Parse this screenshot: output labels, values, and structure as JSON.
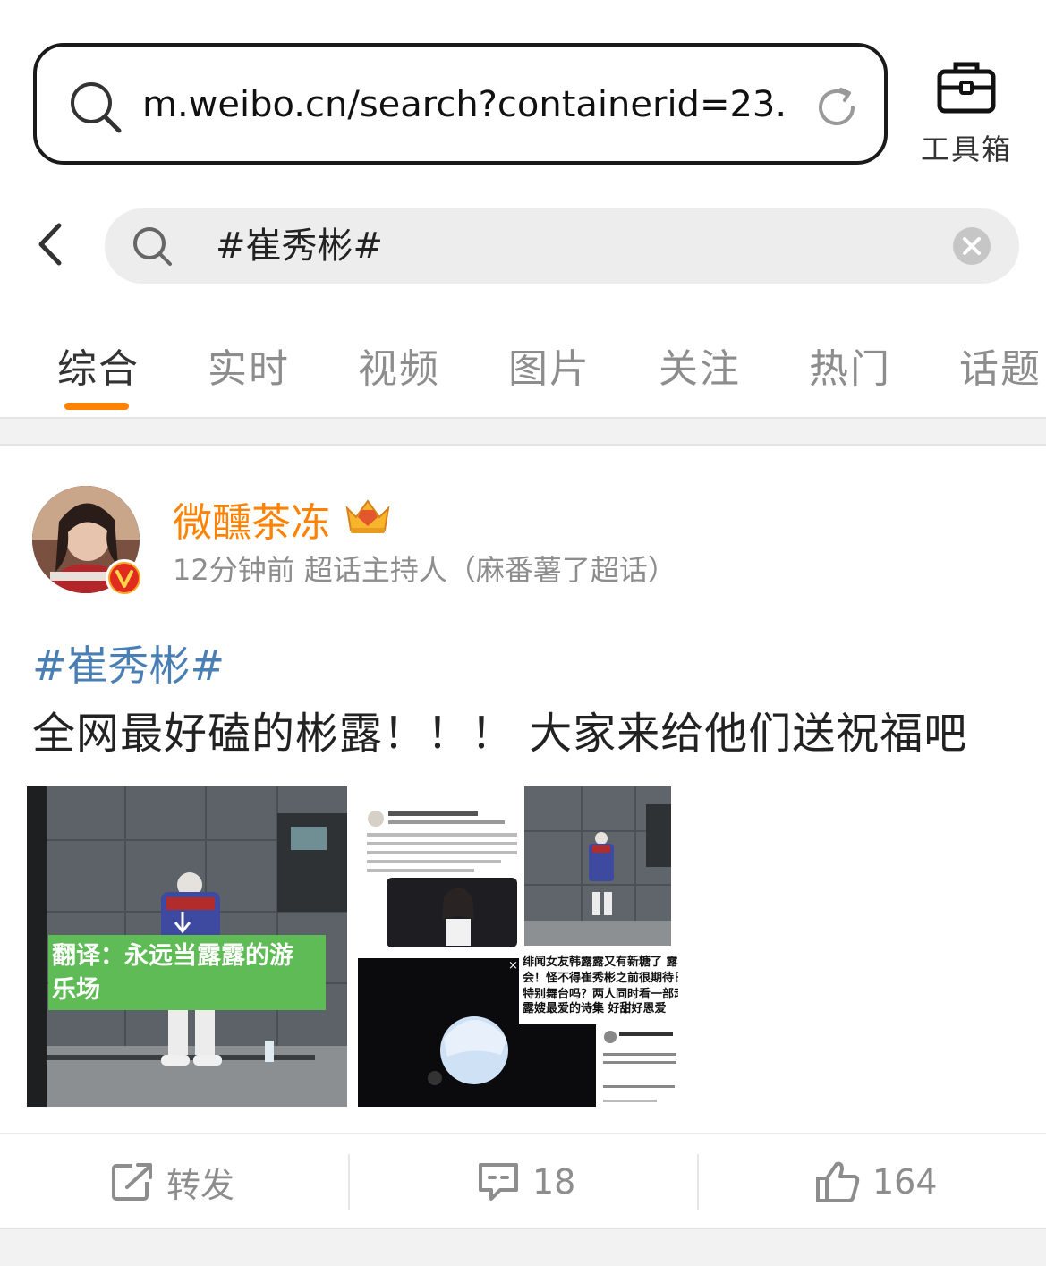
{
  "browser": {
    "url": "m.weibo.cn/search?containerid=23...",
    "toolbox_label": "工具箱"
  },
  "search": {
    "query": "#崔秀彬#"
  },
  "tabs": [
    {
      "label": "综合",
      "active": true
    },
    {
      "label": "实时",
      "active": false
    },
    {
      "label": "视频",
      "active": false
    },
    {
      "label": "图片",
      "active": false
    },
    {
      "label": "关注",
      "active": false
    },
    {
      "label": "热门",
      "active": false
    },
    {
      "label": "话题",
      "active": false
    }
  ],
  "post": {
    "username": "微醺茶冻",
    "meta": "12分钟前 超话主持人（麻番薯了超话）",
    "hashtag": "#崔秀彬#",
    "text": "全网最好磕的彬露！！！ 大家来给他们送祝福吧",
    "images": [
      {
        "overlay_text_line1": "翻译：永远当露露的游",
        "overlay_text_line2": "乐场"
      },
      {
        "caption_line1": "绯闻女友韩露露又有新糖了 露露",
        "caption_line2": "会！怪不得崔秀彬之前很期待日本",
        "caption_line3": "特别舞台吗？两人同时看一部动漫",
        "caption_line4": "露嫂最爱的诗集 好甜好恩爱"
      }
    ],
    "actions": {
      "repost_label": "转发",
      "comment_count": "18",
      "like_count": "164"
    }
  },
  "colors": {
    "accent": "#ff8200",
    "username": "#ff8200",
    "hashtag": "#4a7fb4",
    "muted": "#8d8d8d"
  }
}
